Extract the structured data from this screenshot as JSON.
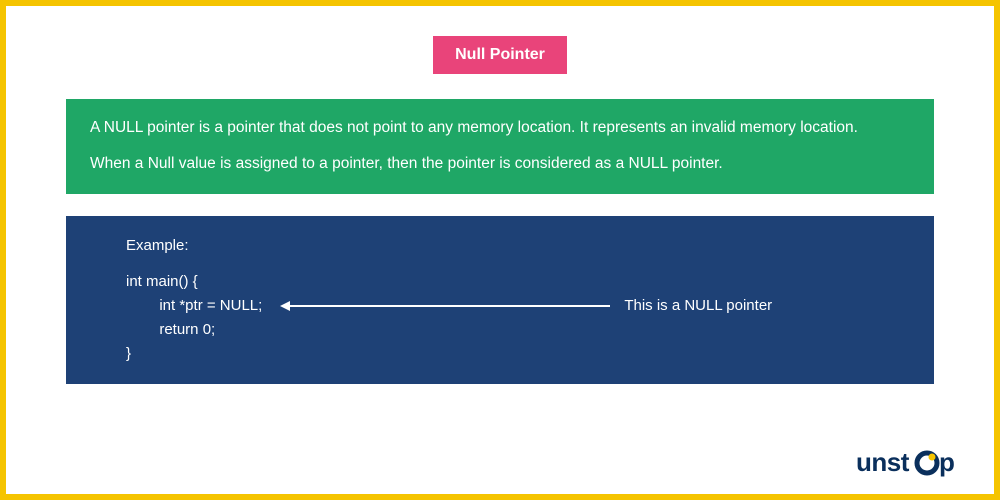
{
  "title": "Null Pointer",
  "description": {
    "p1": "A NULL pointer is a pointer that does not point to any memory location. It represents an invalid memory location.",
    "p2": "When a Null value is assigned to a pointer, then the pointer is considered as a NULL pointer."
  },
  "example": {
    "label": "Example:",
    "line1": "int main() {",
    "line2": "        int *ptr = NULL;",
    "line3": "        return 0;",
    "line4": "}",
    "annotation": "This is a NULL pointer"
  },
  "brand": {
    "name": "unstop"
  },
  "colors": {
    "frame": "#f5c400",
    "title_bg": "#e9447a",
    "desc_bg": "#1fa766",
    "code_bg": "#1e4176",
    "brand": "#0a2f5c"
  }
}
